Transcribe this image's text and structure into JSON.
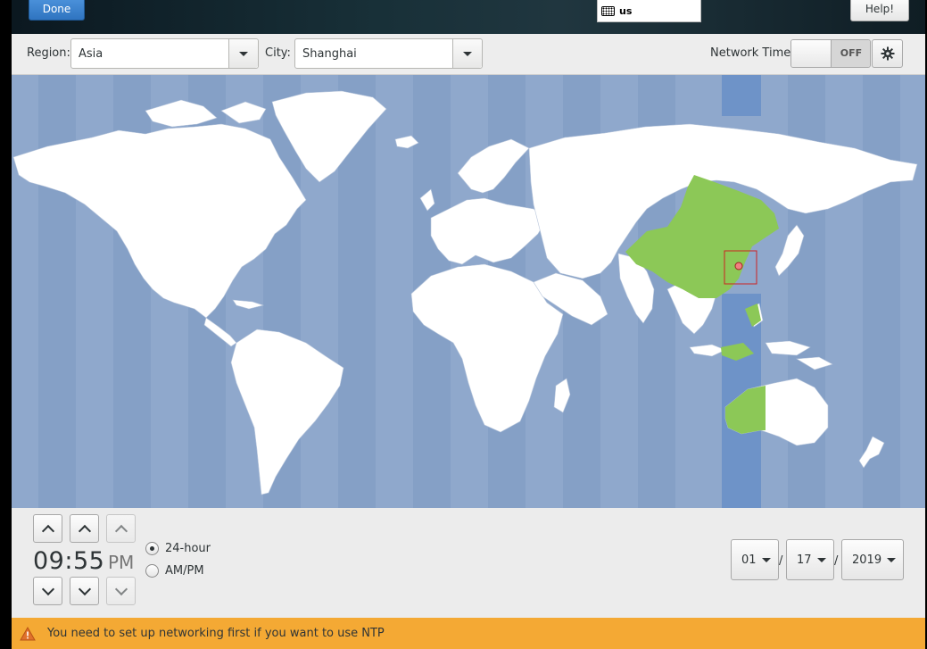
{
  "header": {
    "done_label": "Done",
    "keyboard_layout": "us",
    "help_label": "Help!"
  },
  "toolbar": {
    "region_label": "Region:",
    "region_value": "Asia",
    "city_label": "City:",
    "city_value": "Shanghai",
    "network_time_label": "Network Time",
    "network_time_state": "OFF"
  },
  "time": {
    "value": "09:55",
    "period": "PM",
    "format_24h_label": "24-hour",
    "format_ampm_label": "AM/PM",
    "selected_format": "24-hour"
  },
  "date": {
    "month": "01",
    "day": "17",
    "year": "2019",
    "separator": "/"
  },
  "warning": {
    "text": "You need to set up networking first if you want to use NTP"
  },
  "colors": {
    "ocean": "#8fa8cc",
    "timezone_band": "#6e93c8",
    "land": "#ffffff",
    "highlighted_zone": "#8cc857",
    "accent_button": "#3b82cc",
    "warning_bar": "#f4a934"
  }
}
